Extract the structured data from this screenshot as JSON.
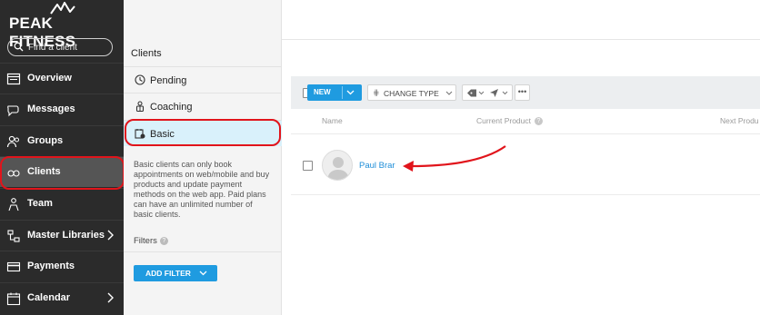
{
  "brand": {
    "name": "PEAK FITNESS"
  },
  "search": {
    "placeholder": "Find a client"
  },
  "nav": {
    "items": [
      {
        "label": "Overview",
        "icon": "overview-icon"
      },
      {
        "label": "Messages",
        "icon": "messages-icon"
      },
      {
        "label": "Groups",
        "icon": "groups-icon"
      },
      {
        "label": "Clients",
        "icon": "clients-icon"
      },
      {
        "label": "Team",
        "icon": "team-icon"
      },
      {
        "label": "Master Libraries",
        "icon": "master-libraries-icon"
      },
      {
        "label": "Payments",
        "icon": "payments-icon"
      },
      {
        "label": "Calendar",
        "icon": "calendar-icon"
      }
    ]
  },
  "panel": {
    "title": "Clients",
    "tabs": [
      {
        "label": "Pending",
        "icon": "clock-icon"
      },
      {
        "label": "Coaching",
        "icon": "coaching-icon"
      },
      {
        "label": "Basic",
        "icon": "basic-icon"
      }
    ],
    "description": "Basic clients can only book appointments on web/mobile and buy products and update payment methods on the web app. Paid plans can have an unlimited number of basic clients.",
    "filters_label": "Filters",
    "add_filter_label": "ADD FILTER"
  },
  "toolbar": {
    "new_label": "NEW",
    "change_type_label": "CHANGE TYPE",
    "more_label": "•••"
  },
  "table": {
    "headers": [
      "Name",
      "Current Product",
      "Next Produ"
    ],
    "rows": [
      {
        "name": "Paul Brar"
      }
    ]
  },
  "colors": {
    "sidebar_bg": "#2b2b2b",
    "accent": "#1f9be0",
    "active_tab": "#d9f1fb",
    "annotation": "#e1141b"
  }
}
